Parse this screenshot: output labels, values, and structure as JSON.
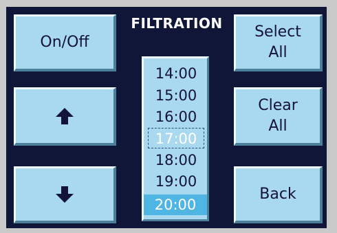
{
  "screen": {
    "title": "FILTRATION"
  },
  "buttons": {
    "on_off": "On/Off",
    "select_all": "Select\nAll",
    "clear_all": "Clear\nAll",
    "back": "Back",
    "up_icon": "arrow-up-icon",
    "down_icon": "arrow-down-icon"
  },
  "time_list": {
    "items": [
      "14:00",
      "15:00",
      "16:00",
      "17:00",
      "18:00",
      "19:00",
      "20:00"
    ],
    "focused": "17:00",
    "selected": "20:00"
  },
  "colors": {
    "screen_bg": "#101637",
    "button_bg": "#a9d9ef",
    "selected_row": "#4fb5e3",
    "title_text": "#ffffff"
  }
}
